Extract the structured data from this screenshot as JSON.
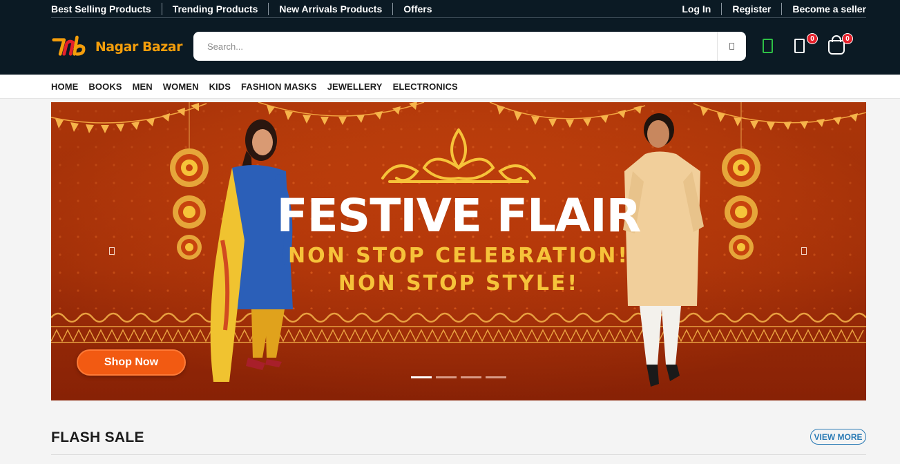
{
  "top_links": {
    "left": [
      "Best Selling Products",
      "Trending Products",
      "New Arrivals Products",
      "Offers"
    ],
    "right": [
      "Log In",
      "Register",
      "Become a seller"
    ]
  },
  "logo": {
    "text": "Nagar Bazar"
  },
  "search": {
    "placeholder": "Search...",
    "value": ""
  },
  "header_icons": {
    "phone": "phone-icon",
    "wishlist": "wishlist-icon",
    "wishlist_count": "0",
    "cart": "shopping-bag-icon",
    "cart_count": "0"
  },
  "categories": [
    "HOME",
    "BOOKS",
    "MEN",
    "WOMEN",
    "KIDS",
    "FASHION MASKS",
    "JEWELLERY",
    "ELECTRONICS"
  ],
  "banner": {
    "headline": "FESTIVE FLAIR",
    "line1": "NON STOP CELEBRATION!",
    "line2": "NON STOP STYLE!",
    "cta": "Shop Now",
    "slide_count": 4,
    "active_slide": 1
  },
  "flash_sale": {
    "title": "FLASH SALE",
    "view_more": "VIEW MORE"
  },
  "colors": {
    "header_bg": "#0b1a24",
    "banner_orange": "#c5420c",
    "cta_orange": "#f25a12",
    "link_blue": "#2b7bb5",
    "badge_red": "#e5202b",
    "phone_green": "#2ec046",
    "gold": "#f6c33a"
  }
}
